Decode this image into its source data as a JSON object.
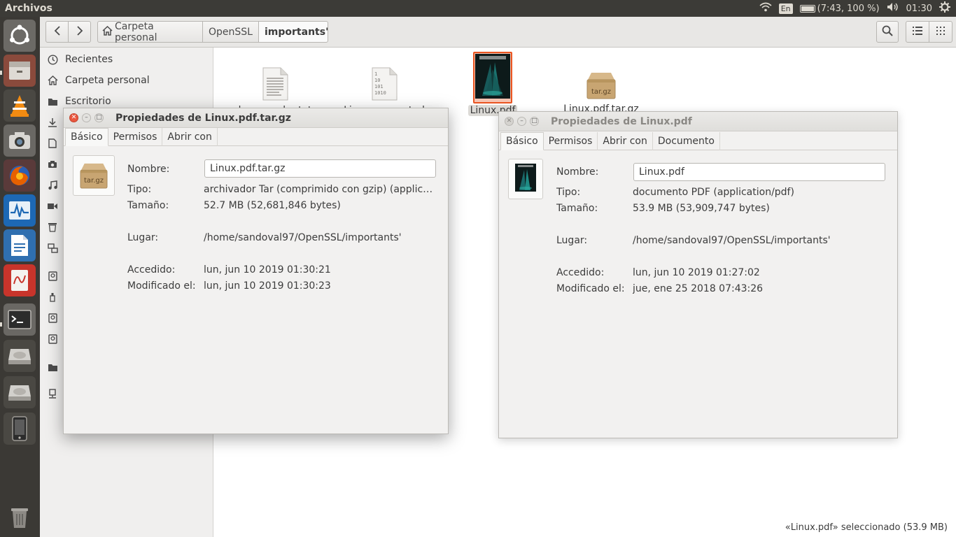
{
  "top_panel": {
    "app_title": "Archivos",
    "keyboard_layout": "En",
    "battery_text": "(7:43, 100 %)",
    "clock": "01:30"
  },
  "toolbar": {
    "back_icon": "chevron-left-icon",
    "forward_icon": "chevron-right-icon",
    "breadcrumbs": [
      "Carpeta personal",
      "OpenSSL",
      "importants'"
    ],
    "search_icon": "search-icon",
    "list_view_icon": "list-view-icon",
    "grid_view_icon": "grid-view-icon"
  },
  "sidebar": {
    "items": [
      {
        "label": "Recientes",
        "icon": "clock-icon"
      },
      {
        "label": "Carpeta personal",
        "icon": "home-icon"
      },
      {
        "label": "Escritorio",
        "icon": "folder-icon"
      }
    ]
  },
  "files": [
    {
      "name": "key_prueba.txt",
      "type": "text"
    },
    {
      "name": "Linux_encrypted",
      "type": "binary"
    },
    {
      "name": "Linux.pdf",
      "type": "pdf",
      "selected": true
    },
    {
      "name": "Linux.pdf.tar.gz",
      "type": "archive"
    }
  ],
  "status_text": "«Linux.pdf» seleccionado  (53.9 MB)",
  "dialog_targz": {
    "title": "Propiedades de Linux.pdf.tar.gz",
    "tabs": [
      "Básico",
      "Permisos",
      "Abrir con"
    ],
    "icon_text": "tar.gz",
    "labels": {
      "name": "Nombre:",
      "type": "Tipo:",
      "size": "Tamaño:",
      "location": "Lugar:",
      "accessed": "Accedido:",
      "modified": "Modificado el:"
    },
    "name": "Linux.pdf.tar.gz",
    "type": "archivador Tar (comprimido con gzip) (applicat…",
    "size": "52.7 MB (52,681,846 bytes)",
    "location": "/home/sandoval97/OpenSSL/importants'",
    "accessed": "lun, jun 10 2019 01:30:21",
    "modified": "lun, jun 10 2019 01:30:23"
  },
  "dialog_pdf": {
    "title": "Propiedades de Linux.pdf",
    "tabs": [
      "Básico",
      "Permisos",
      "Abrir con",
      "Documento"
    ],
    "labels": {
      "name": "Nombre:",
      "type": "Tipo:",
      "size": "Tamaño:",
      "location": "Lugar:",
      "accessed": "Accedido:",
      "modified": "Modificado el:"
    },
    "name": "Linux.pdf",
    "type": "documento PDF (application/pdf)",
    "size": "53.9 MB (53,909,747 bytes)",
    "location": "/home/sandoval97/OpenSSL/importants'",
    "accessed": "lun, jun 10 2019 01:27:02",
    "modified": "jue, ene 25 2018 07:43:26"
  },
  "colors": {
    "accent": "#e95420",
    "panel": "#3c3b37",
    "launcher": "#3b3935"
  }
}
